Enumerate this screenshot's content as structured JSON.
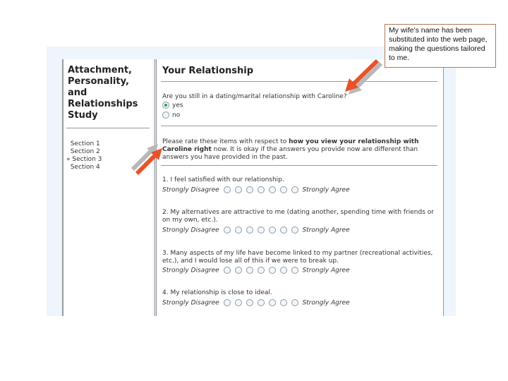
{
  "callout": {
    "text": "My wife's name has been substituted into the web page, making the questions tailored to me."
  },
  "sidebar": {
    "study_title_lines": [
      "Attachment,",
      "Personality,",
      "and",
      "Relationships",
      "Study"
    ],
    "sections": [
      {
        "label": "  Section 1",
        "current": false
      },
      {
        "label": "  Section 2",
        "current": false
      },
      {
        "label": "» Section 3",
        "current": true
      },
      {
        "label": "  Section 4",
        "current": false
      }
    ]
  },
  "main": {
    "title": "Your Relationship",
    "question": "Are you still in a dating/marital relationship with Caroline?",
    "options": [
      {
        "label": "yes",
        "selected": true
      },
      {
        "label": "no",
        "selected": false
      }
    ],
    "instructions_prefix": "Please rate these items with respect to ",
    "instructions_bold": "how you view your relationship with Caroline right",
    "instructions_suffix": " now. It is okay if the answers you provide now are different than answers you have provided in the past.",
    "scale_left": "Strongly Disagree",
    "scale_right": "Strongly Agree",
    "scale_points": 7,
    "items": [
      {
        "text": "1. I feel satisfied with our relationship."
      },
      {
        "text": "2. My alternatives are attractive to me (dating another, spending time with friends or on my own, etc.)."
      },
      {
        "text": "3. Many aspects of my life have become linked to my partner (recreational activities, etc.), and I would lose all of this if we were to break up."
      },
      {
        "text": "4. My relationship is close to ideal."
      }
    ]
  },
  "colors": {
    "arrow_orange": "#e8522a",
    "arrow_shadow": "#b8b8b8",
    "callout_border": "#b07a5a",
    "radio_selected": "#2a9a4a"
  }
}
